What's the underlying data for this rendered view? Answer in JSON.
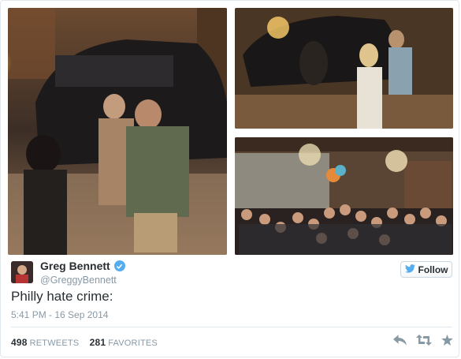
{
  "tweet": {
    "author_name": "Greg Bennett",
    "author_handle": "@GreggyBennett",
    "text": "Philly hate crime:",
    "timestamp": "5:41 PM - 16 Sep 2014"
  },
  "follow": {
    "label": "Follow"
  },
  "stats": {
    "retweets_count": "498",
    "retweets_label": "RETWEETS",
    "favorites_count": "281",
    "favorites_label": "FAVORITES"
  },
  "icons": {
    "verified": "verified-badge-icon",
    "follow_bird": "twitter-bird-icon",
    "reply": "reply-icon",
    "retweet": "retweet-icon",
    "favorite": "star-icon"
  },
  "colors": {
    "twitter_blue": "#55acee",
    "meta_gray": "#8899a6",
    "text_dark": "#292f33"
  }
}
